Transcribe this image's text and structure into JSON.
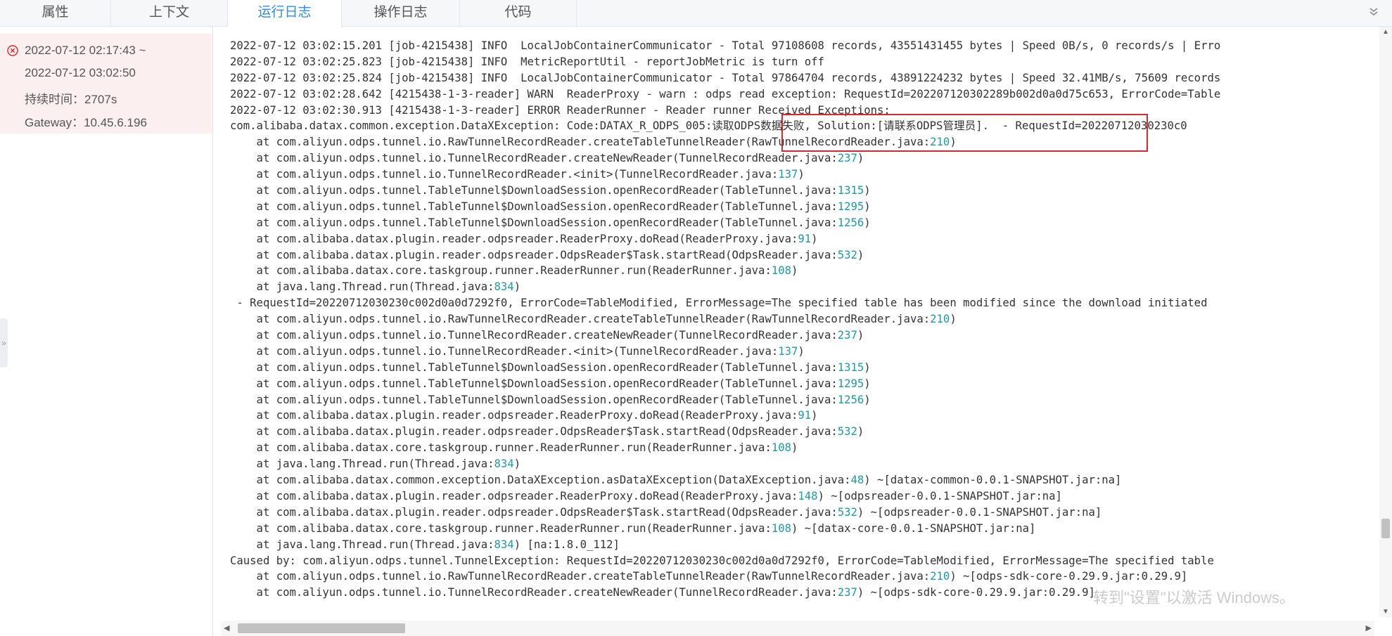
{
  "tabs": [
    {
      "label": "属性"
    },
    {
      "label": "上下文"
    },
    {
      "label": "运行日志"
    },
    {
      "label": "操作日志"
    },
    {
      "label": "代码"
    }
  ],
  "active_tab": "运行日志",
  "collapse_icon": "double-chevron-down",
  "job_info": {
    "status_icon": "error-circle",
    "start_time": "2022-07-12 02:17:43 ~",
    "end_time": "2022-07-12 03:02:50",
    "duration": "持续时间：2707s",
    "gateway": "Gateway：10.45.6.196"
  },
  "colors": {
    "accent": "#2d8cf0",
    "error": "#e0262d",
    "number": "#1a9ba6"
  },
  "log_lines": [
    "2022-07-12 03:02:15.201 [job-4215438] INFO  LocalJobContainerCommunicator - Total 97108608 records, 43551431455 bytes | Speed 0B/s, 0 records/s | Erro",
    "2022-07-12 03:02:25.823 [job-4215438] INFO  MetricReportUtil - reportJobMetric is turn off",
    "2022-07-12 03:02:25.824 [job-4215438] INFO  LocalJobContainerCommunicator - Total 97864704 records, 43891224232 bytes | Speed 32.41MB/s, 75609 records",
    "2022-07-12 03:02:28.642 [4215438-1-3-reader] WARN  ReaderProxy - warn : odps read exception: RequestId=202207120302289b002d0a0d75c653, ErrorCode=Table",
    "2022-07-12 03:02:30.913 [4215438-1-3-reader] ERROR ReaderRunner - Reader runner Received Exceptions:",
    "com.alibaba.datax.common.exception.DataXException: Code:DATAX_R_ODPS_005:读取ODPS数据失败, Solution:[请联系ODPS管理员].  - RequestId=20220712030230c0",
    "    at com.aliyun.odps.tunnel.io.RawTunnelRecordReader.createTableTunnelReader(RawTunnelRecordReader.java:210)",
    "    at com.aliyun.odps.tunnel.io.TunnelRecordReader.createNewReader(TunnelRecordReader.java:237)",
    "    at com.aliyun.odps.tunnel.io.TunnelRecordReader.<init>(TunnelRecordReader.java:137)",
    "    at com.aliyun.odps.tunnel.TableTunnel$DownloadSession.openRecordReader(TableTunnel.java:1315)",
    "    at com.aliyun.odps.tunnel.TableTunnel$DownloadSession.openRecordReader(TableTunnel.java:1295)",
    "    at com.aliyun.odps.tunnel.TableTunnel$DownloadSession.openRecordReader(TableTunnel.java:1256)",
    "    at com.alibaba.datax.plugin.reader.odpsreader.ReaderProxy.doRead(ReaderProxy.java:91)",
    "    at com.alibaba.datax.plugin.reader.odpsreader.OdpsReader$Task.startRead(OdpsReader.java:532)",
    "    at com.alibaba.datax.core.taskgroup.runner.ReaderRunner.run(ReaderRunner.java:108)",
    "    at java.lang.Thread.run(Thread.java:834)",
    " - RequestId=20220712030230c002d0a0d7292f0, ErrorCode=TableModified, ErrorMessage=The specified table has been modified since the download initiated",
    "    at com.aliyun.odps.tunnel.io.RawTunnelRecordReader.createTableTunnelReader(RawTunnelRecordReader.java:210)",
    "    at com.aliyun.odps.tunnel.io.TunnelRecordReader.createNewReader(TunnelRecordReader.java:237)",
    "    at com.aliyun.odps.tunnel.io.TunnelRecordReader.<init>(TunnelRecordReader.java:137)",
    "    at com.aliyun.odps.tunnel.TableTunnel$DownloadSession.openRecordReader(TableTunnel.java:1315)",
    "    at com.aliyun.odps.tunnel.TableTunnel$DownloadSession.openRecordReader(TableTunnel.java:1295)",
    "    at com.aliyun.odps.tunnel.TableTunnel$DownloadSession.openRecordReader(TableTunnel.java:1256)",
    "    at com.alibaba.datax.plugin.reader.odpsreader.ReaderProxy.doRead(ReaderProxy.java:91)",
    "    at com.alibaba.datax.plugin.reader.odpsreader.OdpsReader$Task.startRead(OdpsReader.java:532)",
    "    at com.alibaba.datax.core.taskgroup.runner.ReaderRunner.run(ReaderRunner.java:108)",
    "    at java.lang.Thread.run(Thread.java:834)",
    "    at com.alibaba.datax.common.exception.DataXException.asDataXException(DataXException.java:48) ~[datax-common-0.0.1-SNAPSHOT.jar:na]",
    "    at com.alibaba.datax.plugin.reader.odpsreader.ReaderProxy.doRead(ReaderProxy.java:148) ~[odpsreader-0.0.1-SNAPSHOT.jar:na]",
    "    at com.alibaba.datax.plugin.reader.odpsreader.OdpsReader$Task.startRead(OdpsReader.java:532) ~[odpsreader-0.0.1-SNAPSHOT.jar:na]",
    "    at com.alibaba.datax.core.taskgroup.runner.ReaderRunner.run(ReaderRunner.java:108) ~[datax-core-0.0.1-SNAPSHOT.jar:na]",
    "    at java.lang.Thread.run(Thread.java:834) [na:1.8.0_112]",
    "Caused by: com.aliyun.odps.tunnel.TunnelException: RequestId=20220712030230c002d0a0d7292f0, ErrorCode=TableModified, ErrorMessage=The specified table",
    "    at com.aliyun.odps.tunnel.io.RawTunnelRecordReader.createTableTunnelReader(RawTunnelRecordReader.java:210) ~[odps-sdk-core-0.29.9.jar:0.29.9]",
    "    at com.aliyun.odps.tunnel.io.TunnelRecordReader.createNewReader(TunnelRecordReader.java:237) ~[odps-sdk-core-0.29.9.jar:0.29.9]"
  ],
  "watermark": "转到\"设置\"以激活 Windows。"
}
